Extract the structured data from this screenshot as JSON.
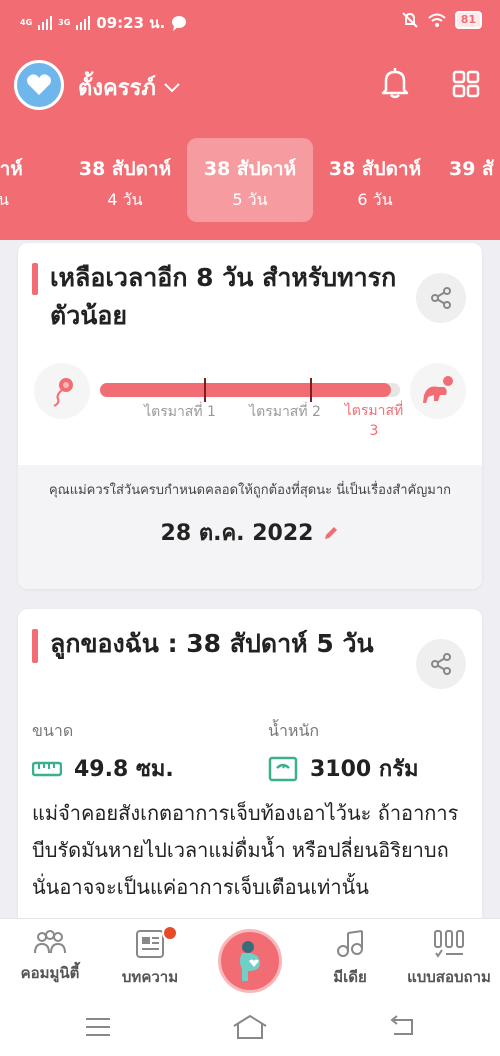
{
  "status_bar": {
    "signal1": "4G",
    "signal2": "3G",
    "time": "09:23 น.",
    "battery": "81"
  },
  "header": {
    "app_title": "ตั้งครรภ์"
  },
  "weeks": [
    {
      "week": "ปดาห์",
      "day": "วัน"
    },
    {
      "week": "38 สัปดาห์",
      "day": "4 วัน"
    },
    {
      "week": "38 สัปดาห์",
      "day": "5 วัน"
    },
    {
      "week": "38 สัปดาห์",
      "day": "6 วัน"
    },
    {
      "week": "39 สั",
      "day": ""
    }
  ],
  "countdown_card": {
    "title": "เหลือเวลาอีก 8 วัน สำหรับทารกตัวน้อย",
    "progress": 0.97,
    "trimesters": [
      "ไตรมาสที่ 1",
      "ไตรมาสที่ 2",
      "ไตรมาสที่ 3"
    ],
    "due_note": "คุณแม่ควรใส่วันครบกำหนดคลอดให้ถูกต้องที่สุดนะ นี่เป็นเรื่องสำคัญมาก",
    "due_date": "28 ต.ค. 2022"
  },
  "baby_card": {
    "title": "ลูกของฉัน : 38 สัปดาห์ 5 วัน",
    "size_label": "ขนาด",
    "size_value": "49.8 ซม.",
    "weight_label": "น้ำหนัก",
    "weight_value": "3100 กรัม",
    "description": "แม่จำคอยสังเกตอาการเจ็บท้องเอาไว้นะ ถ้าอาการบีบรัดมันหายไปเวลาแม่ดื่มน้ำ หรือปลี่ยนอิริยาบถ นั่นอาจจะเป็นแค่อาการเจ็บเตือนเท่านั้น"
  },
  "bottom_nav": {
    "community": "คอมมูนิตี้",
    "articles": "บทความ",
    "media": "มีเดีย",
    "quiz": "แบบสอบถาม"
  },
  "colors": {
    "primary": "#f26d73",
    "avatar": "#6fb6ea",
    "badge": "#e64b2a",
    "measure": "#3bb08f"
  }
}
